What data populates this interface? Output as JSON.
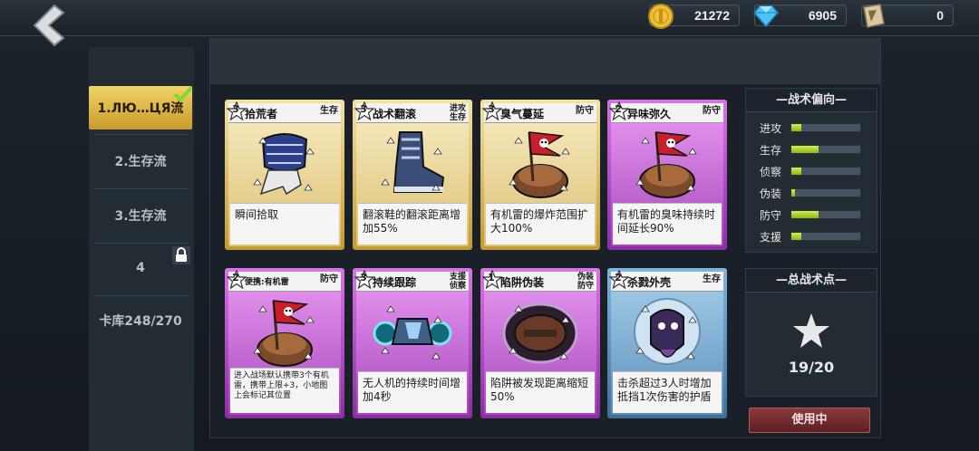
{
  "resources": [
    {
      "name": "coin",
      "icon": "coin-icon",
      "value": "21272"
    },
    {
      "name": "diamond",
      "icon": "diamond-icon",
      "value": "6905"
    },
    {
      "name": "ticket",
      "icon": "ticket-icon",
      "value": "0"
    }
  ],
  "tabs": [
    {
      "label": "1.ЛЮ…ЦЯ流",
      "active": true
    },
    {
      "label": "2.生存流",
      "active": false
    },
    {
      "label": "3.生存流",
      "active": false
    },
    {
      "label": "4",
      "active": false,
      "locked": true
    },
    {
      "label": "卡库248/270",
      "active": false
    }
  ],
  "cards": [
    {
      "cost": "3",
      "name": "拾荒者",
      "tag": "生存",
      "rarity": "gold",
      "art": "armor-icon",
      "desc": "瞬间拾取"
    },
    {
      "cost": "3",
      "name": "战术翻滚",
      "tag": "进攻\n生存",
      "rarity": "gold",
      "art": "boot-icon",
      "desc": "翻滚鞋的翻滚距离增加55%"
    },
    {
      "cost": "3",
      "name": "臭气蔓延",
      "tag": "防守",
      "rarity": "gold",
      "art": "mine-flag-icon",
      "desc": "有机雷的爆炸范围扩大100%"
    },
    {
      "cost": "2",
      "name": "异味弥久",
      "tag": "防守",
      "rarity": "purple",
      "art": "mine-flag-icon",
      "desc": "有机雷的臭味持续时间延长90%"
    },
    {
      "cost": "2",
      "name": "便携:有机雷",
      "tag": "防守",
      "rarity": "purple",
      "art": "mine-flag-icon",
      "desc": "进入战场默认携带3个有机雷，携带上限+3，小地图上会标记其位置"
    },
    {
      "cost": "3",
      "name": "持续跟踪",
      "tag": "支援\n侦察",
      "rarity": "purple",
      "art": "drone-icon",
      "desc": "无人机的持续时间增加4秒"
    },
    {
      "cost": "1",
      "name": "陷阱伪装",
      "tag": "伪装\n防守",
      "rarity": "purple",
      "art": "trap-icon",
      "desc": "陷阱被发现距离缩短50%"
    },
    {
      "cost": "2",
      "name": "杀戮外壳",
      "tag": "生存",
      "rarity": "blue",
      "art": "shell-icon",
      "desc": "击杀超过3人时增加抵挡1次伤害的护盾"
    }
  ],
  "tactics": {
    "title": "—战术偏向—",
    "stats": [
      {
        "label": "进攻",
        "value": 0.15
      },
      {
        "label": "生存",
        "value": 0.4
      },
      {
        "label": "侦察",
        "value": 0.15
      },
      {
        "label": "伪装",
        "value": 0.05
      },
      {
        "label": "防守",
        "value": 0.4
      },
      {
        "label": "支援",
        "value": 0.15
      }
    ]
  },
  "total_points": {
    "title": "—总战术点—",
    "value": "19/20"
  },
  "in_use_label": "使用中",
  "colors": {
    "gold": "#d9b44a",
    "purple": "#b24dc8",
    "blue": "#5d90ba",
    "accent_green": "#9ed62a",
    "in_use_red": "#7a2d30"
  }
}
